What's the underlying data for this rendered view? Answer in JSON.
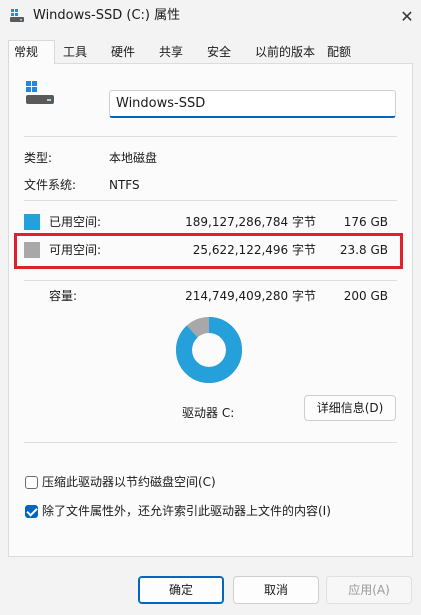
{
  "window": {
    "title": "Windows-SSD (C:) 属性",
    "close_glyph": "✕"
  },
  "tabs": [
    {
      "label": "常规",
      "active": true
    },
    {
      "label": "工具"
    },
    {
      "label": "硬件"
    },
    {
      "label": "共享"
    },
    {
      "label": "安全"
    },
    {
      "label": "以前的版本"
    },
    {
      "label": "配额"
    }
  ],
  "general": {
    "drive_name": "Windows-SSD",
    "type_label": "类型:",
    "type_value": "本地磁盘",
    "fs_label": "文件系统:",
    "fs_value": "NTFS",
    "used": {
      "label": "已用空间:",
      "bytes": "189,127,286,784 字节",
      "size": "176 GB",
      "color": "#26a0da"
    },
    "free": {
      "label": "可用空间:",
      "bytes": "25,622,122,496 字节",
      "size": "23.8 GB",
      "color": "#a8a8a8"
    },
    "capacity": {
      "label": "容量:",
      "bytes": "214,749,409,280 字节",
      "size": "200 GB"
    },
    "used_fraction": 0.8807,
    "drive_label": "驱动器 C:",
    "details_button": "详细信息(D)",
    "compress_label": "压缩此驱动器以节约磁盘空间(C)",
    "compress_checked": false,
    "index_label": "除了文件属性外，还允许索引此驱动器上文件的内容(I)",
    "index_checked": true
  },
  "footer": {
    "ok": "确定",
    "cancel": "取消",
    "apply": "应用(A)"
  },
  "colors": {
    "accent": "#0067c0",
    "highlight": "#e0202a"
  }
}
